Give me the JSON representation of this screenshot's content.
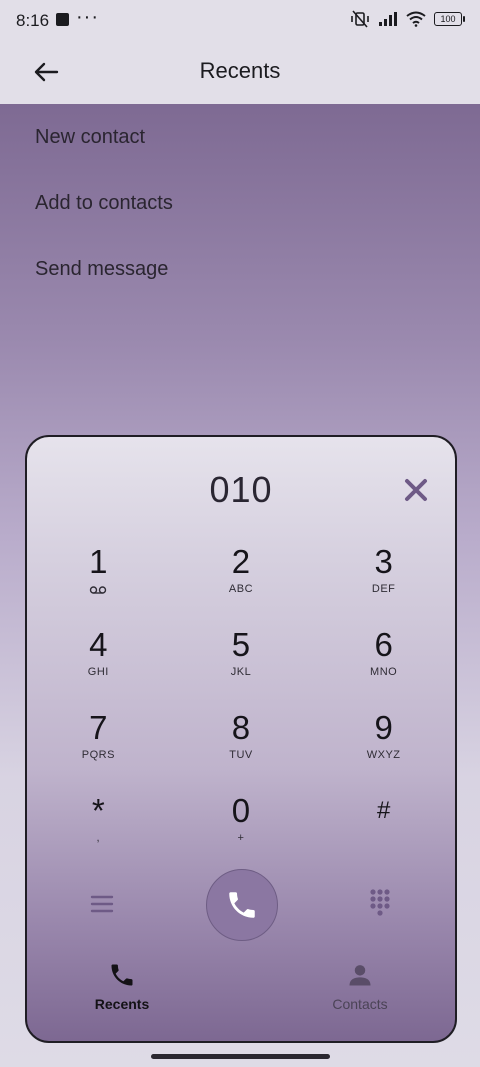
{
  "status_bar": {
    "time": "8:16",
    "dots": "···",
    "battery": "100"
  },
  "app_bar": {
    "title": "Recents"
  },
  "menu": {
    "items": [
      "New contact",
      "Add to contacts",
      "Send message"
    ]
  },
  "dialpad": {
    "number": "010",
    "keys": [
      {
        "digit": "1",
        "sub": ""
      },
      {
        "digit": "2",
        "sub": "ABC"
      },
      {
        "digit": "3",
        "sub": "DEF"
      },
      {
        "digit": "4",
        "sub": "GHI"
      },
      {
        "digit": "5",
        "sub": "JKL"
      },
      {
        "digit": "6",
        "sub": "MNO"
      },
      {
        "digit": "7",
        "sub": "PQRS"
      },
      {
        "digit": "8",
        "sub": "TUV"
      },
      {
        "digit": "9",
        "sub": "WXYZ"
      },
      {
        "digit": "*",
        "sub": ","
      },
      {
        "digit": "0",
        "sub": "+"
      },
      {
        "digit": "#",
        "sub": ""
      }
    ]
  },
  "bottom_nav": {
    "recents": "Recents",
    "contacts": "Contacts"
  },
  "colors": {
    "accent": "#8b77a2",
    "sheet_bottom": "#7d6892",
    "icon_muted": "#6e5a86"
  }
}
